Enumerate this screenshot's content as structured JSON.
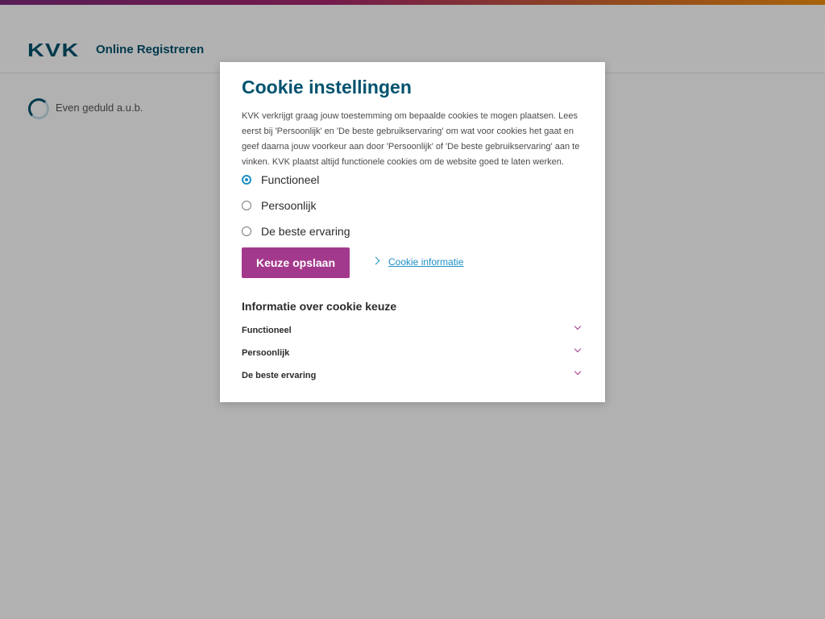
{
  "header": {
    "logo_text": "KVK",
    "app_title": "Online Registreren"
  },
  "loading": {
    "text": "Even geduld a.u.b."
  },
  "modal": {
    "title": "Cookie instellingen",
    "intro": "KVK verkrijgt graag jouw toestemming om bepaalde cookies te mogen plaatsen. Lees eerst bij 'Persoonlijk' en 'De beste gebruikservaring' om wat voor cookies het gaat en geef daarna jouw voorkeur aan door 'Persoonlijk' of 'De beste gebruikservaring' aan te vinken. KVK plaatst altijd functionele cookies om de website goed te laten werken.",
    "options": [
      {
        "label": "Functioneel",
        "checked": true
      },
      {
        "label": "Persoonlijk",
        "checked": false
      },
      {
        "label": "De beste ervaring",
        "checked": false
      }
    ],
    "save_button": "Keuze opslaan",
    "info_link": "Cookie informatie",
    "section_title": "Informatie over cookie keuze",
    "accordion": [
      {
        "label": "Functioneel"
      },
      {
        "label": "Persoonlijk"
      },
      {
        "label": "De beste ervaring"
      }
    ]
  },
  "colors": {
    "brand_blue": "#00526e",
    "accent_purple": "#a3398c",
    "link_blue": "#1e8fc4"
  }
}
